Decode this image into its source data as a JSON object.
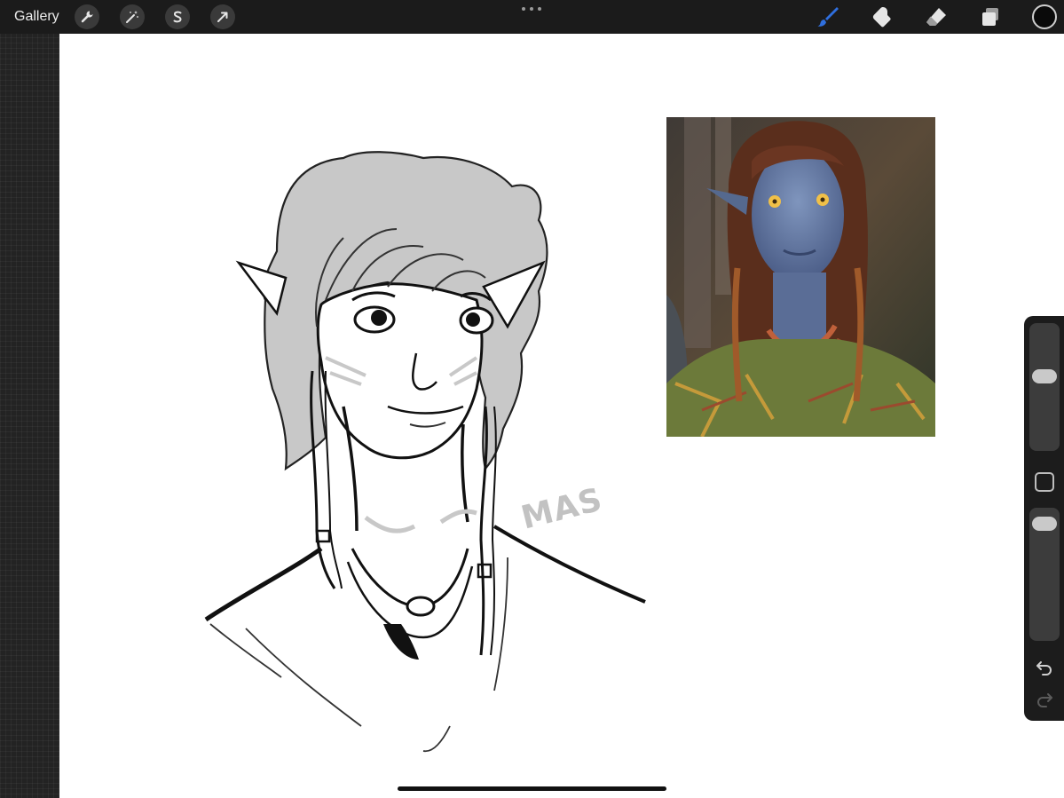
{
  "toolbar": {
    "gallery_label": "Gallery",
    "left_tools": [
      "wrench-icon",
      "magic-wand-icon",
      "selection-s-icon",
      "transform-arrow-icon"
    ],
    "right_tools": [
      "brush-icon",
      "smudge-icon",
      "eraser-icon",
      "layers-icon"
    ],
    "active_tool": "brush-icon",
    "active_color": "#0a0a0a",
    "accent_color": "#2f6fde"
  },
  "canvas": {
    "signature": "MAS",
    "background_color": "#ffffff"
  },
  "sidebar": {
    "brush_size_level": 0.6,
    "opacity_level": 0.95,
    "tools": [
      "modify-square-icon",
      "undo-icon",
      "redo-icon"
    ]
  }
}
